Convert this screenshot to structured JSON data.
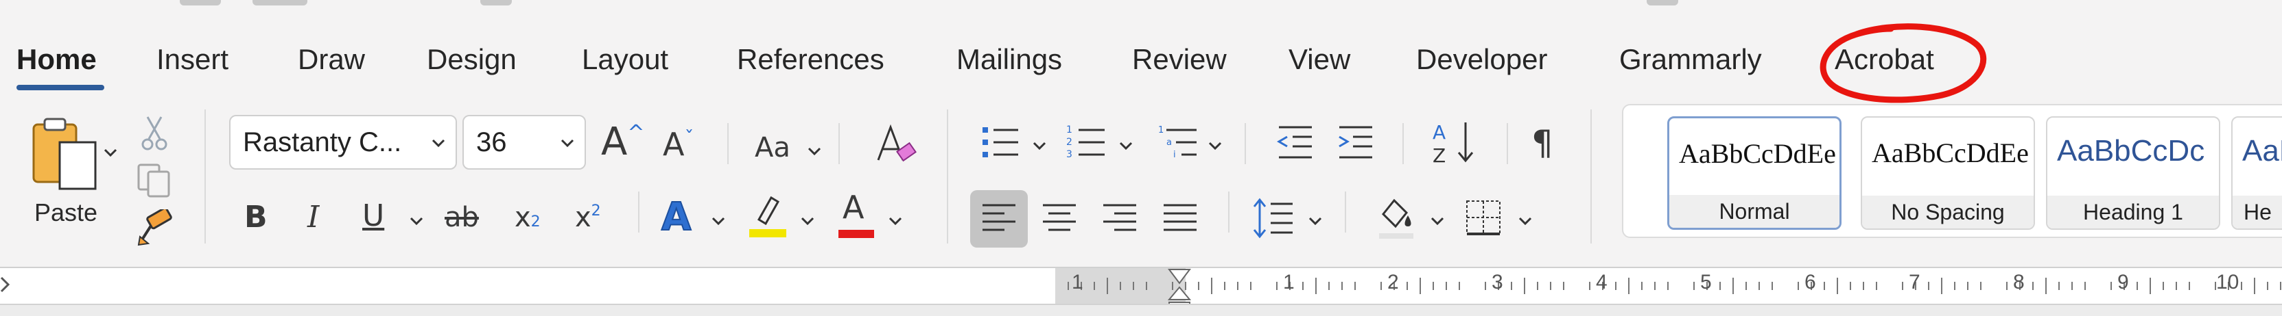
{
  "tabs": [
    {
      "label": "Home",
      "active": true
    },
    {
      "label": "Insert"
    },
    {
      "label": "Draw"
    },
    {
      "label": "Design"
    },
    {
      "label": "Layout"
    },
    {
      "label": "References"
    },
    {
      "label": "Mailings"
    },
    {
      "label": "Review"
    },
    {
      "label": "View"
    },
    {
      "label": "Developer"
    },
    {
      "label": "Grammarly"
    },
    {
      "label": "Acrobat",
      "annotated": "red-circle"
    }
  ],
  "clipboard": {
    "paste_label": "Paste"
  },
  "font": {
    "name": "Rastanty C...",
    "size": "36"
  },
  "styles": [
    {
      "preview": "AaBbCcDdEe",
      "name": "Normal",
      "selected": true
    },
    {
      "preview": "AaBbCcDdEe",
      "name": "No Spacing"
    },
    {
      "preview": "AaBbCcDc",
      "name": "Heading 1"
    },
    {
      "preview": "AaBbC",
      "name": "He"
    }
  ],
  "font_buttons": {
    "change_case": "Aa",
    "bold": "B",
    "italic": "I",
    "underline": "U",
    "strikethrough": "ab",
    "subscript": "x",
    "subscript_mark": "2",
    "superscript": "x",
    "superscript_mark": "2",
    "grow_font": "A",
    "shrink_font": "A",
    "text_effects": "A",
    "font_color": "A"
  },
  "ruler": {
    "numbers": [
      "1",
      "1",
      "2",
      "3",
      "4",
      "5",
      "6",
      "7",
      "8",
      "9",
      "10"
    ]
  },
  "colors": {
    "accent_underline": "#2d5b9a",
    "annotation_red": "#e8150f",
    "highlight_yellow": "#f2e600",
    "font_color_red": "#e31b1b",
    "heading_blue": "#2f5496",
    "list_blue": "#2e6fd0"
  },
  "icons": [
    "paste-icon",
    "cut-icon",
    "copy-icon",
    "format-painter-icon",
    "clear-formatting-icon",
    "bullets-icon",
    "numbering-icon",
    "multilevel-list-icon",
    "decrease-indent-icon",
    "increase-indent-icon",
    "sort-icon",
    "show-formatting-icon",
    "align-left-icon",
    "align-center-icon",
    "align-right-icon",
    "justify-icon",
    "line-spacing-icon",
    "shading-icon",
    "borders-icon"
  ]
}
